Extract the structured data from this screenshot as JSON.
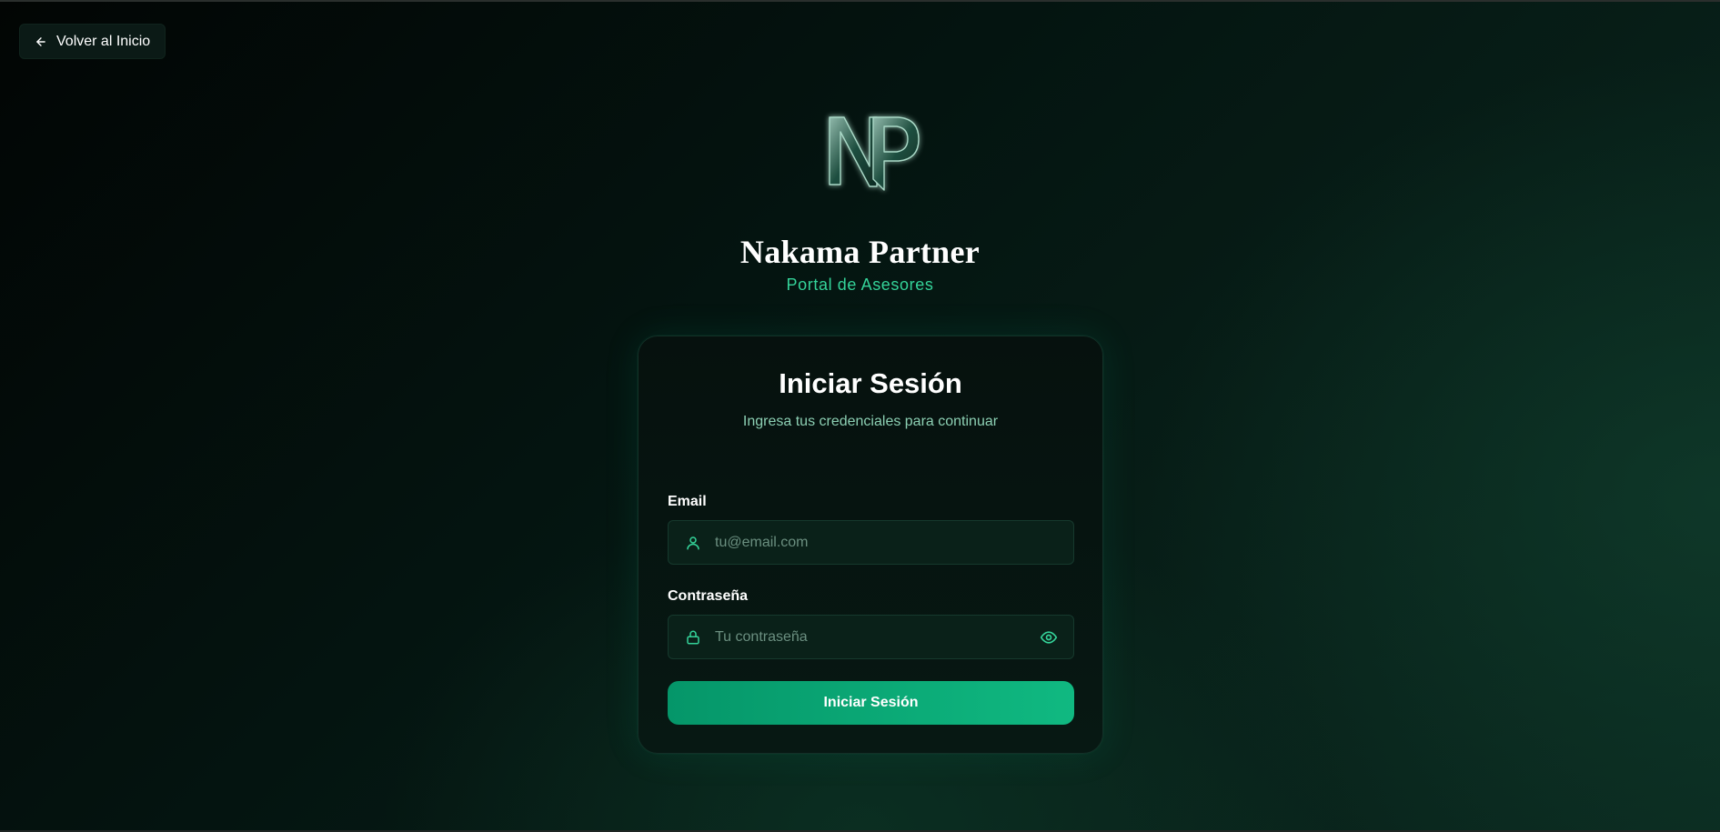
{
  "nav": {
    "back_label": "Volver al Inicio",
    "back_icon": "arrow-left-icon"
  },
  "brand": {
    "logo_letters": "NP",
    "title": "Nakama Partner",
    "subtitle": "Portal de Asesores"
  },
  "login": {
    "title": "Iniciar Sesión",
    "subtitle": "Ingresa tus credenciales para continuar",
    "email_label": "Email",
    "email_placeholder": "tu@email.com",
    "email_value": "",
    "email_icon": "user-icon",
    "password_label": "Contraseña",
    "password_placeholder": "Tu contraseña",
    "password_value": "",
    "password_icon": "lock-icon",
    "toggle_icon": "eye-icon",
    "submit_label": "Iniciar Sesión"
  },
  "colors": {
    "accent": "#10b981",
    "accent_dark": "#059669",
    "subtitle_green": "#34d399",
    "background": "#020504"
  }
}
